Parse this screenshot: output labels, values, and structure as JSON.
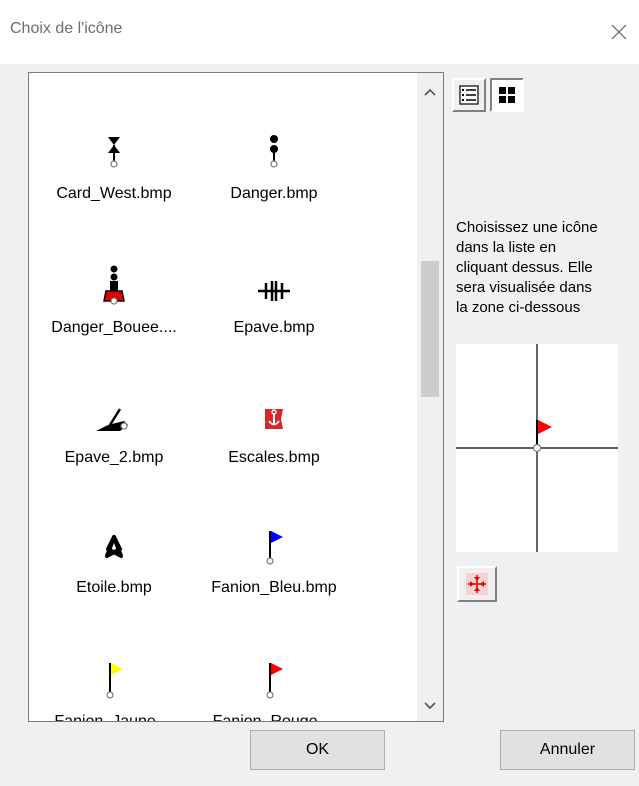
{
  "window": {
    "title": "Choix de l'icône"
  },
  "icon_list": {
    "items": [
      {
        "label": "Card_West.bmp",
        "icon": "cardinal-west-marker-icon"
      },
      {
        "label": "Danger.bmp",
        "icon": "danger-marker-icon"
      },
      {
        "label": "Danger_Bouee....",
        "icon": "danger-buoy-icon"
      },
      {
        "label": "Epave.bmp",
        "icon": "wreck-icon"
      },
      {
        "label": "Epave_2.bmp",
        "icon": "wreck-2-icon"
      },
      {
        "label": "Escales.bmp",
        "icon": "anchor-flag-icon"
      },
      {
        "label": "Etoile.bmp",
        "icon": "star-icon"
      },
      {
        "label": "Fanion_Bleu.bmp",
        "icon": "blue-flag-icon",
        "color": "#0000ff"
      },
      {
        "label": "Fanion_Jaune....",
        "icon": "yellow-flag-icon",
        "color": "#ffff00"
      },
      {
        "label": "Fanion_Rouge....",
        "icon": "red-flag-icon",
        "color": "#ff0000"
      }
    ]
  },
  "help": {
    "text": "Choisissez une icône\ndans la liste en\ncliquant dessus. Elle\nsera visualisée dans\nla zone ci-dessous"
  },
  "buttons": {
    "ok": "OK",
    "cancel": "Annuler"
  },
  "colors": {
    "accent_red": "#ff0000"
  }
}
